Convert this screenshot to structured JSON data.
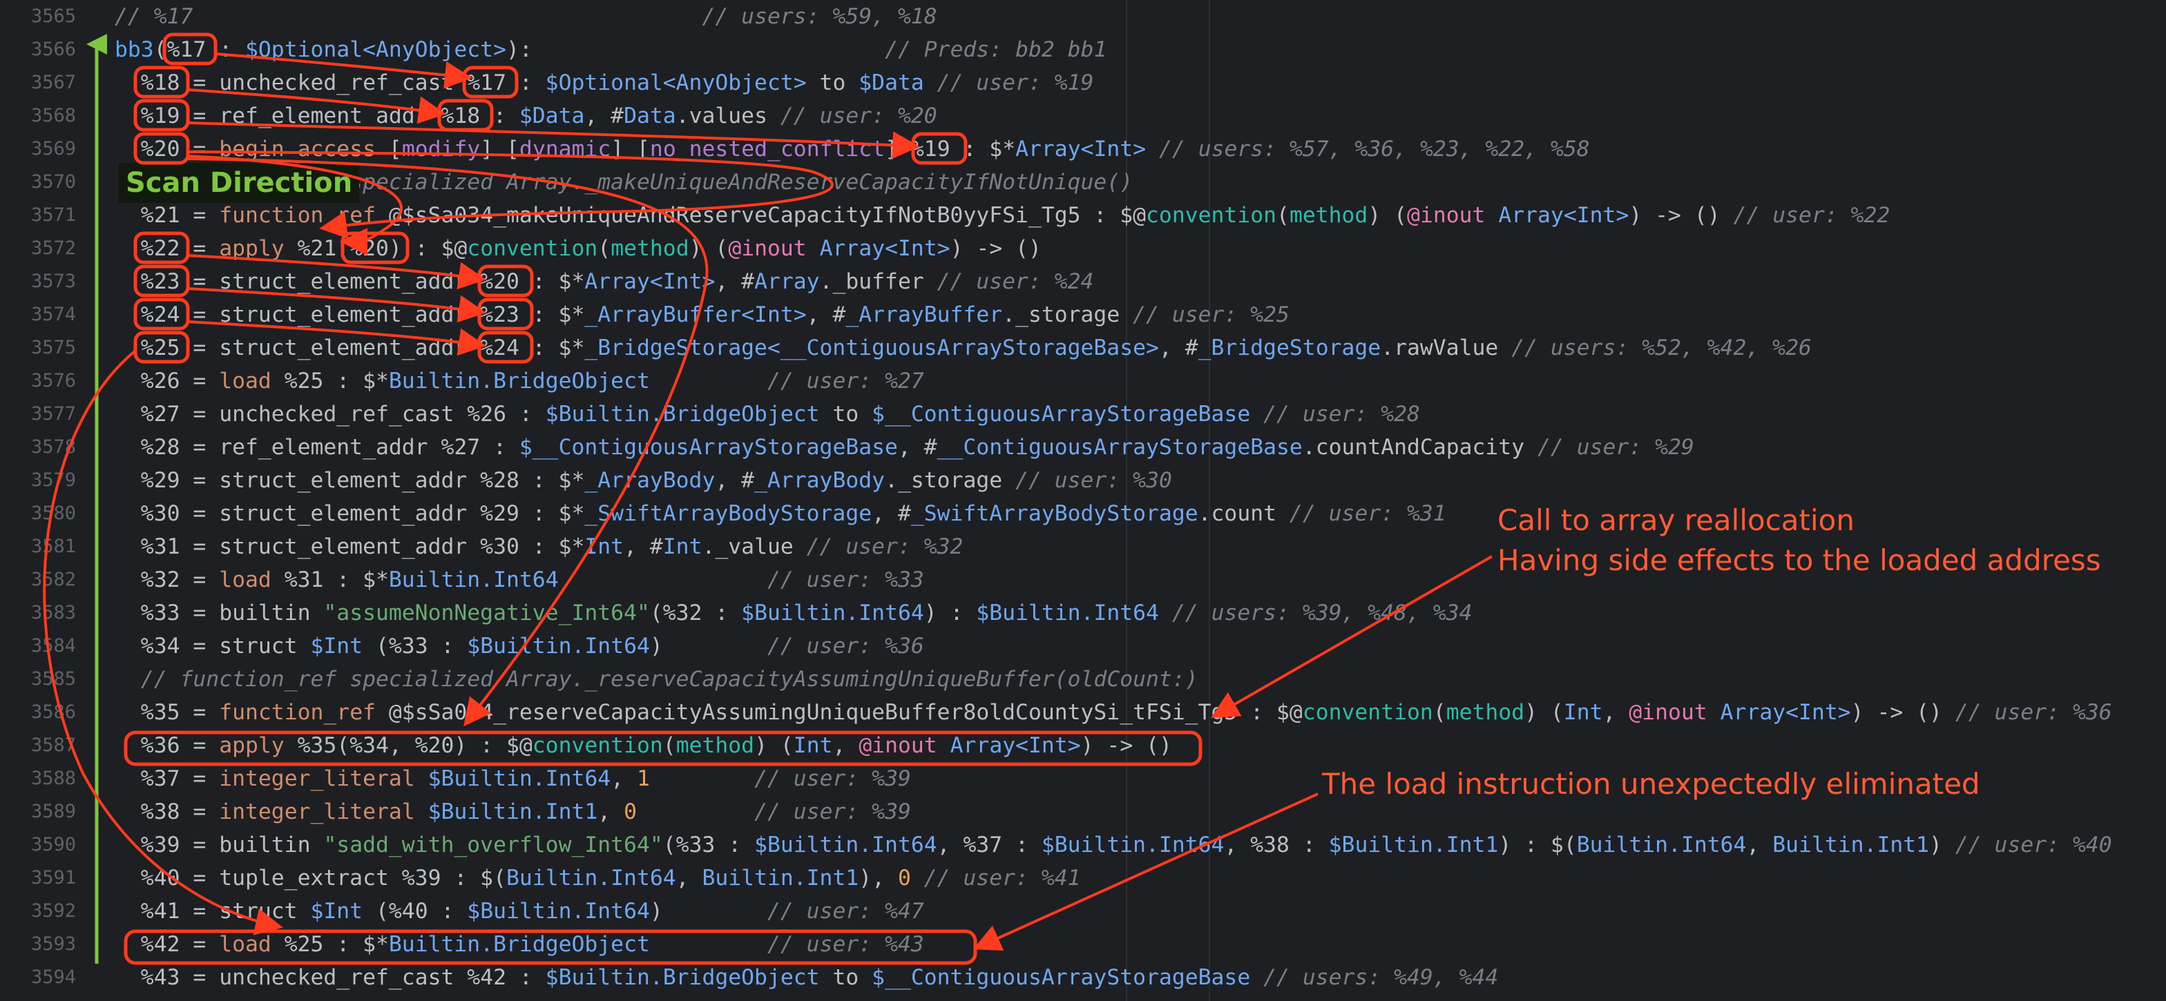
{
  "editor": {
    "lines": [
      {
        "n": "3565",
        "segs": [
          [
            "// %17",
            "com"
          ],
          [
            "                                       ",
            ""
          ],
          [
            "// users: %59, %18",
            "com"
          ]
        ]
      },
      {
        "n": "3566",
        "segs": [
          [
            "bb3",
            "fn"
          ],
          [
            "(%17 : ",
            ""
          ],
          [
            "$Optional<AnyObject>",
            "ty"
          ],
          [
            "):",
            ""
          ],
          [
            "                           ",
            ""
          ],
          [
            "// Preds: bb2 bb1",
            "com"
          ]
        ]
      },
      {
        "n": "3567",
        "segs": [
          [
            "  %18 = unchecked_ref_cast %17 : ",
            ""
          ],
          [
            "$Optional<AnyObject>",
            "ty"
          ],
          [
            " to ",
            ""
          ],
          [
            "$Data",
            "ty"
          ],
          [
            " ",
            ""
          ],
          [
            "// user: %19",
            "com"
          ]
        ]
      },
      {
        "n": "3568",
        "segs": [
          [
            "  %19 = ref_element_addr %18 : ",
            ""
          ],
          [
            "$Data",
            "ty"
          ],
          [
            ", #",
            ""
          ],
          [
            "Data",
            "ty"
          ],
          [
            ".values ",
            ""
          ],
          [
            "// user: %20",
            "com"
          ]
        ]
      },
      {
        "n": "3569",
        "segs": [
          [
            "  %20 = ",
            ""
          ],
          [
            "begin_access",
            "kw"
          ],
          [
            " [",
            ""
          ],
          [
            "modify",
            "attr"
          ],
          [
            "] [",
            ""
          ],
          [
            "dynamic",
            "attr"
          ],
          [
            "] [",
            ""
          ],
          [
            "no_nested_conflict",
            "attr"
          ],
          [
            "] %19 : $*",
            ""
          ],
          [
            "Array<Int>",
            "ty"
          ],
          [
            " ",
            ""
          ],
          [
            "// users: %57, %36, %23, %22, %58",
            "com"
          ]
        ]
      },
      {
        "n": "3570",
        "segs": [
          [
            "  ",
            ""
          ],
          [
            "// function_ref specialized Array._makeUniqueAndReserveCapacityIfNotUnique()",
            "com"
          ]
        ]
      },
      {
        "n": "3571",
        "segs": [
          [
            "  %21 = ",
            ""
          ],
          [
            "function_ref",
            "kw"
          ],
          [
            " @$sSa034_makeUniqueAndReserveCapacityIfNotB0yyFSi_Tg5 : $@",
            ""
          ],
          [
            "convention",
            "cyan"
          ],
          [
            "(",
            ""
          ],
          [
            "method",
            "cyan"
          ],
          [
            ") (",
            ""
          ],
          [
            "@inout",
            "pink"
          ],
          [
            " ",
            ""
          ],
          [
            "Array<Int>",
            "ty"
          ],
          [
            ") -> () ",
            ""
          ],
          [
            "// user: %22",
            "com"
          ]
        ]
      },
      {
        "n": "3572",
        "segs": [
          [
            "  %22 = ",
            ""
          ],
          [
            "apply",
            "kw"
          ],
          [
            " %21(%20) : $@",
            ""
          ],
          [
            "convention",
            "cyan"
          ],
          [
            "(",
            ""
          ],
          [
            "method",
            "cyan"
          ],
          [
            ") (",
            ""
          ],
          [
            "@inout",
            "pink"
          ],
          [
            " ",
            ""
          ],
          [
            "Array<Int>",
            "ty"
          ],
          [
            ") -> ()",
            ""
          ]
        ]
      },
      {
        "n": "3573",
        "segs": [
          [
            "  %23 = struct_element_addr %20 : $*",
            ""
          ],
          [
            "Array<Int>",
            "ty"
          ],
          [
            ", #",
            ""
          ],
          [
            "Array",
            "ty"
          ],
          [
            "._buffer ",
            ""
          ],
          [
            "// user: %24",
            "com"
          ]
        ]
      },
      {
        "n": "3574",
        "segs": [
          [
            "  %24 = struct_element_addr %23 : $*",
            ""
          ],
          [
            "_ArrayBuffer<Int>",
            "ty"
          ],
          [
            ", #",
            ""
          ],
          [
            "_ArrayBuffer",
            "ty"
          ],
          [
            "._storage ",
            ""
          ],
          [
            "// user: %25",
            "com"
          ]
        ]
      },
      {
        "n": "3575",
        "segs": [
          [
            "  %25 = struct_element_addr %24 : $*",
            ""
          ],
          [
            "_BridgeStorage<__ContiguousArrayStorageBase>",
            "ty"
          ],
          [
            ", #",
            ""
          ],
          [
            "_BridgeStorage",
            "ty"
          ],
          [
            ".rawValue ",
            ""
          ],
          [
            "// users: %52, %42, %26",
            "com"
          ]
        ]
      },
      {
        "n": "3576",
        "segs": [
          [
            "  %26 = ",
            ""
          ],
          [
            "load",
            "kw"
          ],
          [
            " %25 : $*",
            ""
          ],
          [
            "Builtin.BridgeObject",
            "ty"
          ],
          [
            "         ",
            ""
          ],
          [
            "// user: %27",
            "com"
          ]
        ]
      },
      {
        "n": "3577",
        "segs": [
          [
            "  %27 = unchecked_ref_cast %26 : ",
            ""
          ],
          [
            "$Builtin.BridgeObject",
            "ty"
          ],
          [
            " to ",
            ""
          ],
          [
            "$__ContiguousArrayStorageBase",
            "ty"
          ],
          [
            " ",
            ""
          ],
          [
            "// user: %28",
            "com"
          ]
        ]
      },
      {
        "n": "3578",
        "segs": [
          [
            "  %28 = ref_element_addr %27 : ",
            ""
          ],
          [
            "$__ContiguousArrayStorageBase",
            "ty"
          ],
          [
            ", #",
            ""
          ],
          [
            "__ContiguousArrayStorageBase",
            "ty"
          ],
          [
            ".countAndCapacity ",
            ""
          ],
          [
            "// user: %29",
            "com"
          ]
        ]
      },
      {
        "n": "3579",
        "segs": [
          [
            "  %29 = struct_element_addr %28 : $*",
            ""
          ],
          [
            "_ArrayBody",
            "ty"
          ],
          [
            ", #",
            ""
          ],
          [
            "_ArrayBody",
            "ty"
          ],
          [
            "._storage ",
            ""
          ],
          [
            "// user: %30",
            "com"
          ]
        ]
      },
      {
        "n": "3580",
        "segs": [
          [
            "  %30 = struct_element_addr %29 : $*",
            ""
          ],
          [
            "_SwiftArrayBodyStorage",
            "ty"
          ],
          [
            ", #",
            ""
          ],
          [
            "_SwiftArrayBodyStorage",
            "ty"
          ],
          [
            ".count ",
            ""
          ],
          [
            "// user: %31",
            "com"
          ]
        ]
      },
      {
        "n": "3581",
        "segs": [
          [
            "  %31 = struct_element_addr %30 : $*",
            ""
          ],
          [
            "Int",
            "ty"
          ],
          [
            ", #",
            ""
          ],
          [
            "Int",
            "ty"
          ],
          [
            "._value ",
            ""
          ],
          [
            "// user: %32",
            "com"
          ]
        ]
      },
      {
        "n": "3582",
        "segs": [
          [
            "  %32 = ",
            ""
          ],
          [
            "load",
            "kw"
          ],
          [
            " %31 : $*",
            ""
          ],
          [
            "Builtin.Int64",
            "ty"
          ],
          [
            "                ",
            ""
          ],
          [
            "// user: %33",
            "com"
          ]
        ]
      },
      {
        "n": "3583",
        "segs": [
          [
            "  %33 = builtin ",
            ""
          ],
          [
            "\"assumeNonNegative_Int64\"",
            "str"
          ],
          [
            "(%32 : ",
            ""
          ],
          [
            "$Builtin.Int64",
            "ty"
          ],
          [
            ") : ",
            ""
          ],
          [
            "$Builtin.Int64",
            "ty"
          ],
          [
            " ",
            ""
          ],
          [
            "// users: %39, %48, %34",
            "com"
          ]
        ]
      },
      {
        "n": "3584",
        "segs": [
          [
            "  %34 = struct ",
            ""
          ],
          [
            "$Int",
            "ty"
          ],
          [
            " (%33 : ",
            ""
          ],
          [
            "$Builtin.Int64",
            "ty"
          ],
          [
            ")        ",
            ""
          ],
          [
            "// user: %36",
            "com"
          ]
        ]
      },
      {
        "n": "3585",
        "segs": [
          [
            "  ",
            ""
          ],
          [
            "// function_ref specialized Array._reserveCapacityAssumingUniqueBuffer(oldCount:)",
            "com"
          ]
        ]
      },
      {
        "n": "3586",
        "segs": [
          [
            "  %35 = ",
            ""
          ],
          [
            "function_ref",
            "kw"
          ],
          [
            " @$sSa034_reserveCapacityAssumingUniqueBuffer8oldCountySi_tFSi_Tg5 : $@",
            ""
          ],
          [
            "convention",
            "cyan"
          ],
          [
            "(",
            ""
          ],
          [
            "method",
            "cyan"
          ],
          [
            ") (",
            ""
          ],
          [
            "Int",
            "ty"
          ],
          [
            ", ",
            ""
          ],
          [
            "@inout",
            "pink"
          ],
          [
            " ",
            ""
          ],
          [
            "Array<Int>",
            "ty"
          ],
          [
            ") -> () ",
            ""
          ],
          [
            "// user: %36",
            "com"
          ]
        ]
      },
      {
        "n": "3587",
        "segs": [
          [
            "  %36 = ",
            ""
          ],
          [
            "apply",
            "kw"
          ],
          [
            " %35(%34, %20) : $@",
            ""
          ],
          [
            "convention",
            "cyan"
          ],
          [
            "(",
            ""
          ],
          [
            "method",
            "cyan"
          ],
          [
            ") (",
            ""
          ],
          [
            "Int",
            "ty"
          ],
          [
            ", ",
            ""
          ],
          [
            "@inout",
            "pink"
          ],
          [
            " ",
            ""
          ],
          [
            "Array<Int>",
            "ty"
          ],
          [
            ") -> ()",
            ""
          ]
        ]
      },
      {
        "n": "3588",
        "segs": [
          [
            "  %37 = ",
            ""
          ],
          [
            "integer_literal",
            "kw"
          ],
          [
            " ",
            ""
          ],
          [
            "$Builtin.Int64",
            "ty"
          ],
          [
            ", ",
            ""
          ],
          [
            "1",
            "num"
          ],
          [
            "        ",
            ""
          ],
          [
            "// user: %39",
            "com"
          ]
        ]
      },
      {
        "n": "3589",
        "segs": [
          [
            "  %38 = ",
            ""
          ],
          [
            "integer_literal",
            "kw"
          ],
          [
            " ",
            ""
          ],
          [
            "$Builtin.Int1",
            "ty"
          ],
          [
            ", ",
            ""
          ],
          [
            "0",
            "num"
          ],
          [
            "         ",
            ""
          ],
          [
            "// user: %39",
            "com"
          ]
        ]
      },
      {
        "n": "3590",
        "segs": [
          [
            "  %39 = builtin ",
            ""
          ],
          [
            "\"sadd_with_overflow_Int64\"",
            "str"
          ],
          [
            "(%33 : ",
            ""
          ],
          [
            "$Builtin.Int64",
            "ty"
          ],
          [
            ", %37 : ",
            ""
          ],
          [
            "$Builtin.Int64",
            "ty"
          ],
          [
            ", %38 : ",
            ""
          ],
          [
            "$Builtin.Int1",
            "ty"
          ],
          [
            ") : $(",
            ""
          ],
          [
            "Builtin.Int64",
            "ty"
          ],
          [
            ", ",
            ""
          ],
          [
            "Builtin.Int1",
            "ty"
          ],
          [
            ") ",
            ""
          ],
          [
            "// user: %40",
            "com"
          ]
        ]
      },
      {
        "n": "3591",
        "segs": [
          [
            "  %40 = tuple_extract %39 : $(",
            ""
          ],
          [
            "Builtin.Int64",
            "ty"
          ],
          [
            ", ",
            ""
          ],
          [
            "Builtin.Int1",
            "ty"
          ],
          [
            "), ",
            ""
          ],
          [
            "0",
            "num"
          ],
          [
            " ",
            ""
          ],
          [
            "// user: %41",
            "com"
          ]
        ]
      },
      {
        "n": "3592",
        "segs": [
          [
            "  %41 = struct ",
            ""
          ],
          [
            "$Int",
            "ty"
          ],
          [
            " (%40 : ",
            ""
          ],
          [
            "$Builtin.Int64",
            "ty"
          ],
          [
            ")        ",
            ""
          ],
          [
            "// user: %47",
            "com"
          ]
        ]
      },
      {
        "n": "3593",
        "segs": [
          [
            "  %42 = ",
            ""
          ],
          [
            "load",
            "kw"
          ],
          [
            " %25 : $*",
            ""
          ],
          [
            "Builtin.BridgeObject",
            "ty"
          ],
          [
            "         ",
            ""
          ],
          [
            "// user: %43",
            "com"
          ]
        ]
      },
      {
        "n": "3594",
        "segs": [
          [
            "  %43 = unchecked_ref_cast %42 : ",
            ""
          ],
          [
            "$Builtin.BridgeObject",
            "ty"
          ],
          [
            " to ",
            ""
          ],
          [
            "$__ContiguousArrayStorageBase",
            "ty"
          ],
          [
            " ",
            ""
          ],
          [
            "// users: %49, %44",
            "com"
          ]
        ]
      }
    ]
  },
  "annotations": {
    "scan_direction": "Scan Direction",
    "realloc_line1": "Call to array reallocation",
    "realloc_line2": "Having side effects to the loaded address",
    "load_eliminated": "The load instruction unexpectedly eliminated"
  },
  "colors": {
    "background": "#1e1f22",
    "annotation_red": "#ff5b34",
    "scan_green": "#7ec640",
    "line_number": "#5f6368",
    "comment": "#7a7e85",
    "keyword": "#cf8e6d",
    "type": "#6fa8f0"
  }
}
